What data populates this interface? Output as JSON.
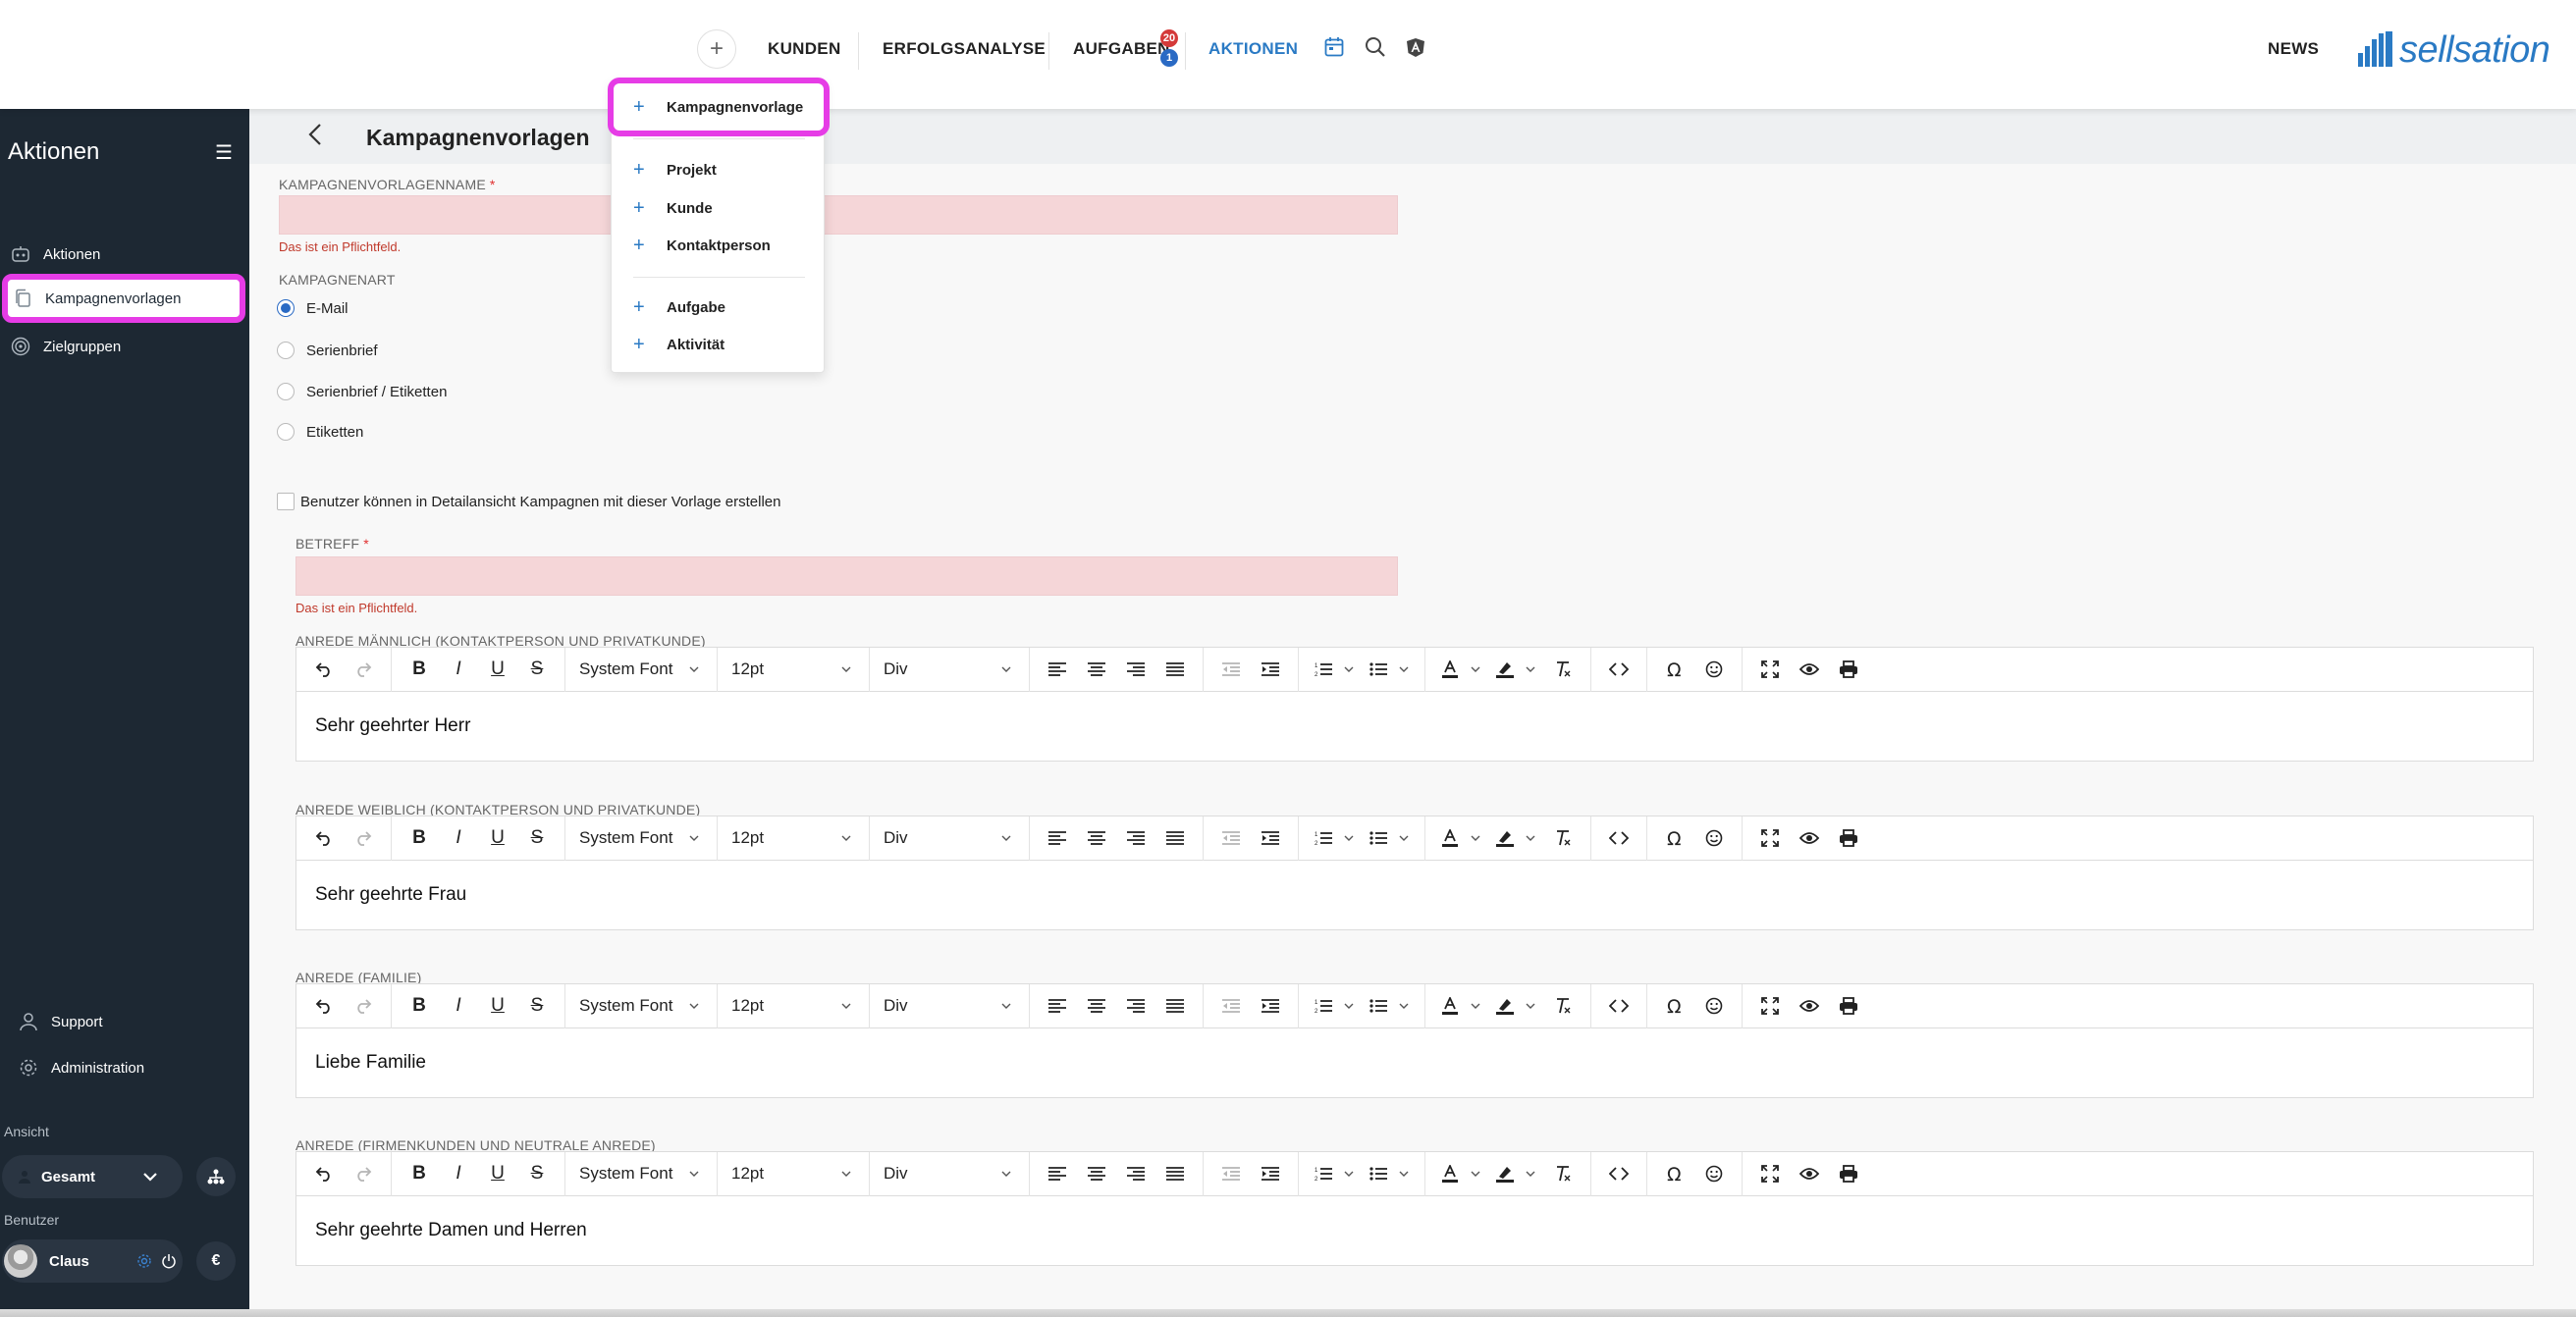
{
  "topbar": {
    "nav": [
      "KUNDEN",
      "ERFOLGSANALYSE",
      "AUFGABEN",
      "AKTIONEN",
      "NEWS"
    ],
    "aufgaben_badge_red": "20",
    "aufgaben_badge_blue": "1",
    "brand": "sellsation",
    "accent_color": "#2a7ac4",
    "icons": [
      "plus-icon",
      "calendar-icon",
      "search-icon",
      "angular-icon"
    ]
  },
  "dropdown": {
    "items": [
      "Kampagnenvorlage",
      "Projekt",
      "Kunde",
      "Kontaktperson",
      "Aufgabe",
      "Aktivität"
    ]
  },
  "sidebar": {
    "title": "Aktionen",
    "items": [
      "Aktionen",
      "Kampagnenvorlagen",
      "Zielgruppen"
    ],
    "support": "Support",
    "administration": "Administration",
    "ansicht_label": "Ansicht",
    "ansicht_value": "Gesamt",
    "benutzer_label": "Benutzer",
    "user_name": "Claus",
    "currency": "€",
    "highlight_color": "#e63ce6"
  },
  "main": {
    "page_title": "Kampagnenvorlagen",
    "name_label": "KAMPAGNENVORLAGENNAME",
    "required_star": "*",
    "required_error": "Das ist ein Pflichtfeld.",
    "kampagnenart_label": "KAMPAGNENART",
    "kampagnenart_options": [
      "E-Mail",
      "Serienbrief",
      "Serienbrief / Etiketten",
      "Etiketten"
    ],
    "kampagnenart_selected": "E-Mail",
    "checkbox_label": "Benutzer können in Detailansicht Kampagnen mit dieser Vorlage erstellen",
    "betreff_label": "BETREFF",
    "editors": [
      {
        "label": "ANREDE MÄNNLICH (KONTAKTPERSON UND PRIVATKUNDE)",
        "content": "Sehr geehrter Herr"
      },
      {
        "label": "ANREDE WEIBLICH (KONTAKTPERSON UND PRIVATKUNDE)",
        "content": "Sehr geehrte Frau"
      },
      {
        "label": "ANREDE (FAMILIE)",
        "content": "Liebe Familie"
      },
      {
        "label": "ANREDE (FIRMENKUNDEN UND NEUTRALE ANREDE)",
        "content": "Sehr geehrte Damen und Herren"
      }
    ],
    "toolbar": {
      "font": "System Font",
      "size": "12pt",
      "block": "Div"
    }
  }
}
